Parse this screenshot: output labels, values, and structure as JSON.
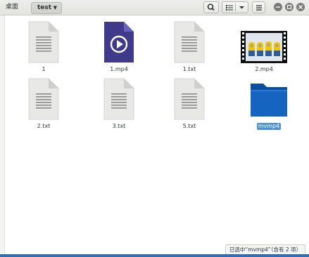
{
  "breadcrumb": {
    "parent": "桌面",
    "current": "test"
  },
  "toolbar": {
    "search_icon": "search-icon",
    "view_icon": "list-view-icon",
    "menu_icon": "hamburger-icon"
  },
  "files": [
    {
      "name": "1",
      "type": "text"
    },
    {
      "name": "1.mp4",
      "type": "video"
    },
    {
      "name": "1.txt",
      "type": "text"
    },
    {
      "name": "2.mp4",
      "type": "video-thumbnail"
    },
    {
      "name": "2.txt",
      "type": "text"
    },
    {
      "name": "3.txt",
      "type": "text"
    },
    {
      "name": "5.txt",
      "type": "text"
    },
    {
      "name": "mvmp4",
      "type": "folder",
      "selected": true
    }
  ],
  "status_text": "已选中“mvmp4”（含有 2 项）",
  "colors": {
    "accent": "#4a90d9",
    "folder": "#1565c0",
    "video": "#3f3a8a"
  }
}
